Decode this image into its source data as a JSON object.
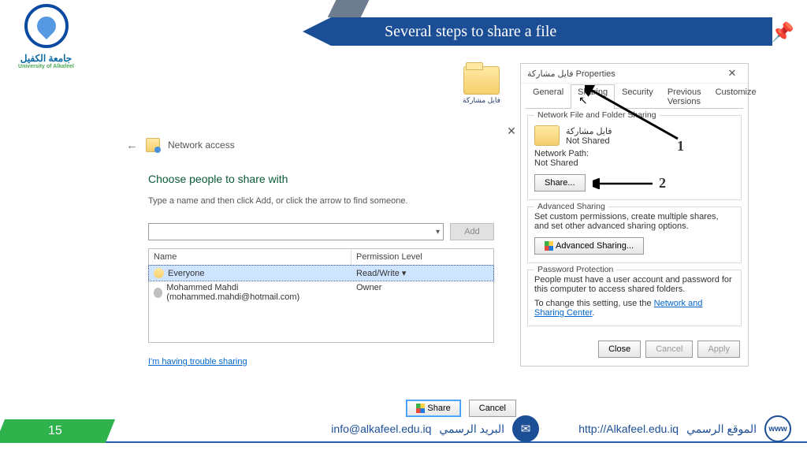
{
  "slide": {
    "title": "Several steps to share a file",
    "page_number": "15",
    "logo_ar": "جامعة الكفيل",
    "logo_en": "University of Alkafeel"
  },
  "mini_folder": {
    "caption": "فايل مشاركة"
  },
  "dialog_access": {
    "header": "Network access",
    "choose": "Choose people to share with",
    "instruction": "Type a name and then click Add, or click the arrow to find someone.",
    "add_btn": "Add",
    "col_name": "Name",
    "col_perm": "Permission Level",
    "rows": [
      {
        "name": "Everyone",
        "perm": "Read/Write ▾"
      },
      {
        "name": "Mohammed Mahdi (mohammed.mahdi@hotmail.com)",
        "perm": "Owner"
      }
    ],
    "trouble": "I'm having trouble sharing",
    "share": "Share",
    "cancel": "Cancel"
  },
  "dialog_props": {
    "title": "فايل مشاركة Properties",
    "tabs": [
      "General",
      "Sharing",
      "Security",
      "Previous Versions",
      "Customize"
    ],
    "nfs_heading": "Network File and Folder Sharing",
    "folder_name": "فايل مشاركة",
    "not_shared": "Not Shared",
    "network_path": "Network Path:",
    "np_value": "Not Shared",
    "share_btn": "Share...",
    "adv_heading": "Advanced Sharing",
    "adv_text": "Set custom permissions, create multiple shares, and set other advanced sharing options.",
    "adv_btn": "Advanced Sharing...",
    "pw_heading": "Password Protection",
    "pw_text1": "People must have a user account and password for this computer to access shared folders.",
    "pw_text2_a": "To change this setting, use the ",
    "pw_link": "Network and Sharing Center",
    "close": "Close",
    "cancel": "Cancel",
    "apply": "Apply"
  },
  "callouts": {
    "one": "1",
    "two": "2"
  },
  "footer": {
    "email_lbl": "البريد الرسمي",
    "email": "info@alkafeel.edu.iq",
    "site_lbl": "الموقع الرسمي",
    "site": "http://Alkafeel.edu.iq"
  }
}
